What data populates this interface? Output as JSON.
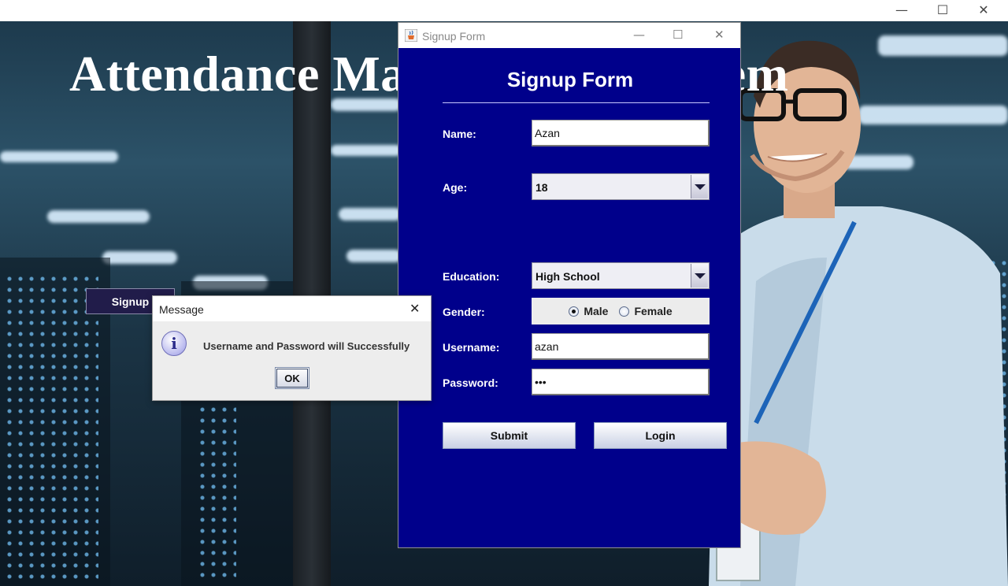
{
  "main_window": {
    "headline": "Attendance Management System",
    "signup_button": "Signup",
    "controls": {
      "minimize": "—",
      "maximize": "☐",
      "close": "✕"
    }
  },
  "signup_form": {
    "window_title": "Signup Form",
    "heading": "Signup Form",
    "controls": {
      "minimize": "—",
      "maximize": "☐",
      "close": "✕"
    },
    "fields": {
      "name_label": "Name:",
      "name_value": "Azan",
      "age_label": "Age:",
      "age_value": "18",
      "education_label": "Education:",
      "education_value": "High School",
      "gender_label": "Gender:",
      "gender_male": "Male",
      "gender_female": "Female",
      "gender_selected": "Male",
      "username_label": "Username:",
      "username_value": "azan",
      "password_label": "Password:",
      "password_value": "•••"
    },
    "submit_button": "Submit",
    "login_button": "Login",
    "colors": {
      "background": "#00008b"
    }
  },
  "message_dialog": {
    "title": "Message",
    "close": "✕",
    "icon": "info-icon",
    "text": "Username and Password will Successfully",
    "ok_button": "OK"
  }
}
